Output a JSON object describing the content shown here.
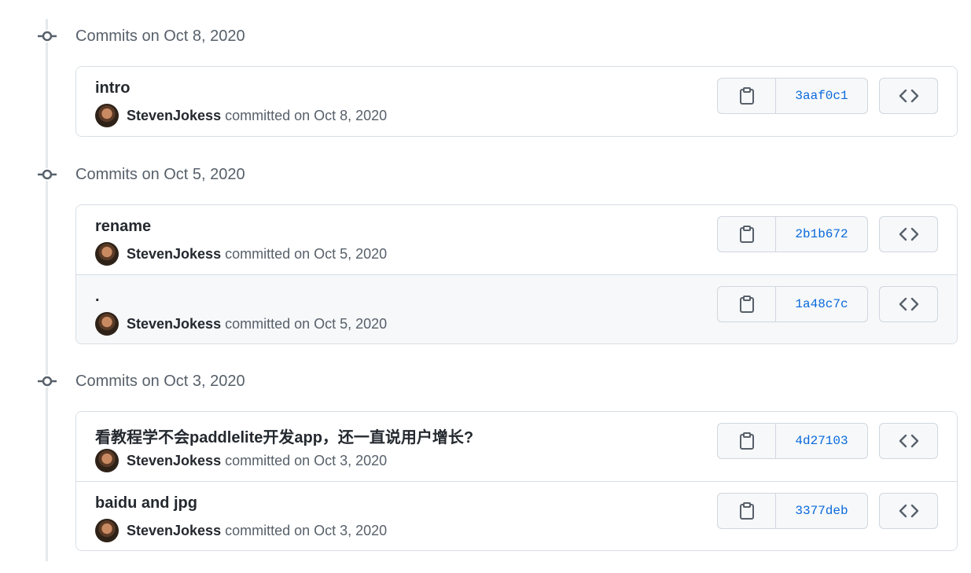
{
  "groups": [
    {
      "title": "Commits on Oct 8, 2020",
      "commits": [
        {
          "message": "intro",
          "author": "StevenJokess",
          "committed": "committed on Oct 8, 2020",
          "sha": "3aaf0c1"
        }
      ]
    },
    {
      "title": "Commits on Oct 5, 2020",
      "commits": [
        {
          "message": "rename",
          "author": "StevenJokess",
          "committed": "committed on Oct 5, 2020",
          "sha": "2b1b672"
        },
        {
          "message": ".",
          "author": "StevenJokess",
          "committed": "committed on Oct 5, 2020",
          "sha": "1a48c7c"
        }
      ]
    },
    {
      "title": "Commits on Oct 3, 2020",
      "commits": [
        {
          "message": "看教程学不会paddlelite开发app，还一直说用户增长?",
          "author": "StevenJokess",
          "committed": "committed on Oct 3, 2020",
          "sha": "4d27103"
        },
        {
          "message": "baidu and jpg",
          "author": "StevenJokess",
          "committed": "committed on Oct 3, 2020",
          "sha": "3377deb"
        }
      ]
    }
  ],
  "icons": {
    "commit_node": "git-commit-icon",
    "copy": "clipboard-icon",
    "browse": "code-icon"
  },
  "colors": {
    "sha_link": "#0969da",
    "text": "#24292f",
    "muted": "#57606a",
    "border": "#d0d7de"
  }
}
